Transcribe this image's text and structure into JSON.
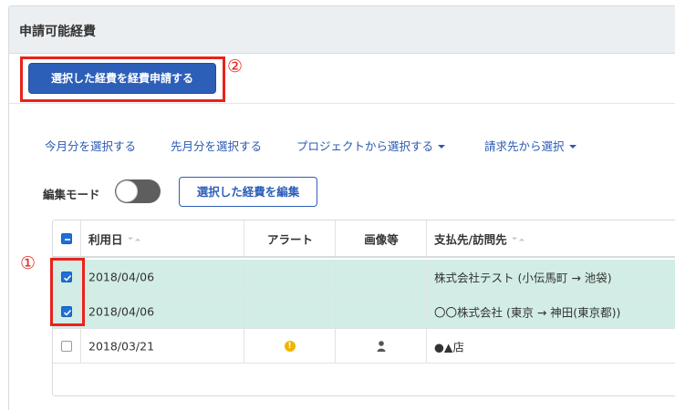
{
  "panel": {
    "title": "申請可能経費"
  },
  "annotations": {
    "marker_1": "①",
    "marker_2": "②"
  },
  "actions": {
    "submit_label": "選択した経費を経費申請する"
  },
  "filters": {
    "this_month": "今月分を選択する",
    "last_month": "先月分を選択する",
    "project": "プロジェクトから選択する",
    "client": "請求先から選択"
  },
  "edit_mode": {
    "label": "編集モード",
    "enabled": false,
    "edit_button_label": "選択した経費を編集"
  },
  "table": {
    "headers": {
      "date": "利用日",
      "alert": "アラート",
      "image": "画像等",
      "payee": "支払先/訪問先"
    },
    "header_checkbox": "indeterminate",
    "rows": [
      {
        "checked": true,
        "date": "2018/04/06",
        "alert": false,
        "image": false,
        "payee": "株式会社テスト (小伝馬町 → 池袋)"
      },
      {
        "checked": true,
        "date": "2018/04/06",
        "alert": false,
        "image": false,
        "payee": "〇〇株式会社 (東京 → 神田(東京都))"
      },
      {
        "checked": false,
        "date": "2018/03/21",
        "alert": true,
        "image": true,
        "payee": "●▲店"
      }
    ]
  },
  "icons": {
    "alert": "exclamation-circle-icon",
    "image": "user-icon",
    "sort": "sort-icon"
  },
  "colors": {
    "primary": "#2d5fb8",
    "link": "#2a5ab1",
    "selected_row": "#d2ede5",
    "annotation_red": "#e8231b",
    "alert": "#f2b400"
  }
}
